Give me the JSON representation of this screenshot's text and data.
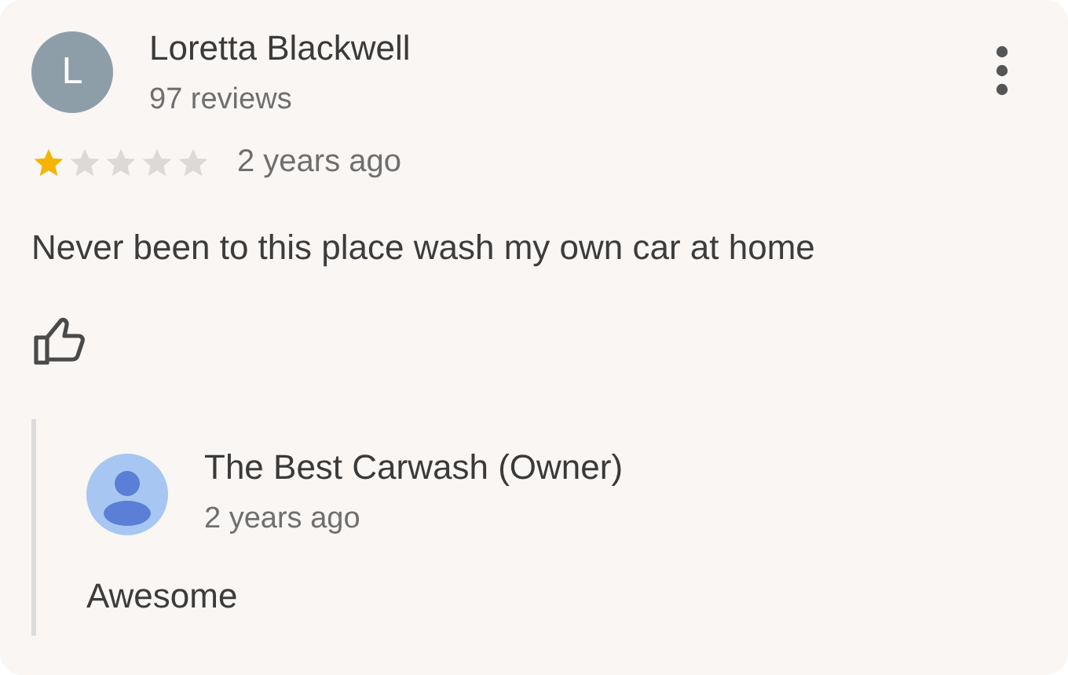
{
  "review": {
    "avatar_letter": "L",
    "author": "Loretta Blackwell",
    "review_count": "97 reviews",
    "stars": 1,
    "time": "2 years ago",
    "text": "Never been to this place wash my own car at home"
  },
  "owner_reply": {
    "author": "The Best Carwash (Owner)",
    "time": "2 years ago",
    "text": "Awesome"
  }
}
